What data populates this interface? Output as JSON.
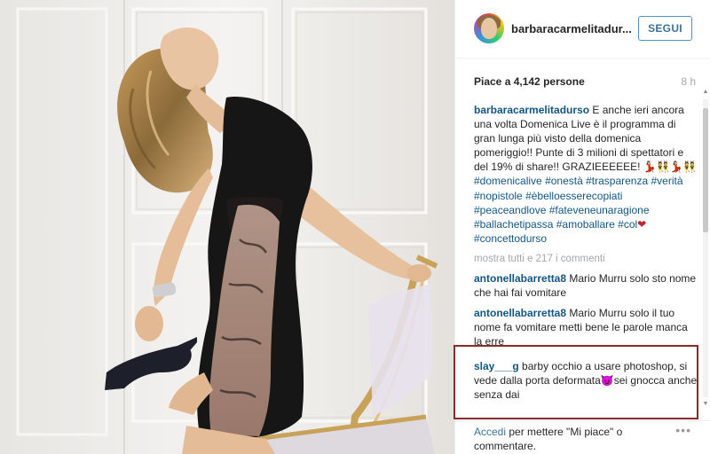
{
  "post": {
    "image_alt": "Woman in black lace dress seated on a chair holding a high heel shoe",
    "header": {
      "username": "barbaracarmelitadur...",
      "follow_label": "SEGUI"
    },
    "likes_text": "Piace a 4,142 persone",
    "time_ago": "8 h",
    "caption": {
      "user": "barbaracarmelitadurso",
      "text": " E anche ieri ancora una volta Domenica Live è il programma di gran lunga più visto della domenica pomeriggio!! Punte di 3 milioni di spettatori e del 19% di share!! GRAZIEEEEEE! 💃🏻👯💃🏻👯 ",
      "hashtags": [
        "#domenicalive",
        "#onestà",
        "#trasparenza",
        "#verità",
        "#nopistole",
        "#èbelloesserecopiati",
        "#peaceandlove",
        "#fateveneunaragione",
        "#ballachetipassa",
        "#amoballare",
        "#col"
      ],
      "heart": "❤",
      "last_hashtag": "#concettodurso"
    },
    "show_all_comments": "mostra tutti e 217 i commenti",
    "comments": [
      {
        "user": "antonellabarretta8",
        "text": " Mario Murru solo sto nome che hai fai vomitare"
      },
      {
        "user": "antonellabarretta8",
        "text": " Mario Murru solo il tuo nome fa vomitare metti bene le parole manca la erre"
      },
      {
        "user": "slay___g",
        "text_before": " barby occhio a usare photoshop, si vede dalla porta deformata",
        "emoji": "😈",
        "text_after": "sei gnocca anche senza dai"
      }
    ],
    "footer": {
      "accedi": "Accedi",
      "rest": " per mettere \"Mi piace\" o commentare.",
      "more": "•••"
    }
  },
  "scrollbar": {
    "up": "▲",
    "down": "▼"
  }
}
